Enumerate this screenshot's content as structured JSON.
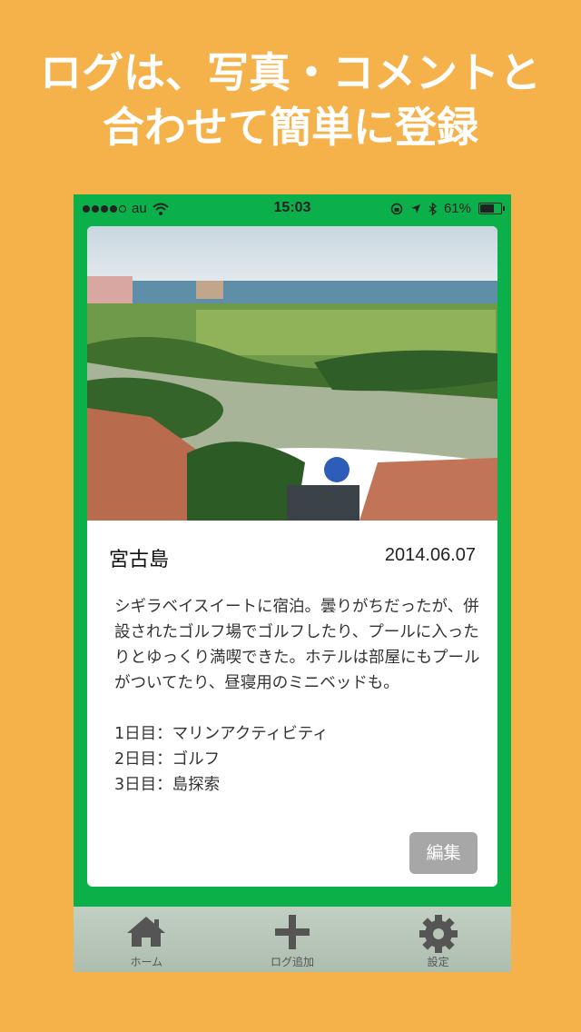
{
  "headline": {
    "line1": "ログは、写真・コメントと",
    "line2": "合わせて簡単に登録"
  },
  "colors": {
    "background": "#f5b24a",
    "frame": "#0bb04a",
    "tabbar": "#b6c6b7",
    "edit_button": "#a7a7a7"
  },
  "status_bar": {
    "carrier": "au",
    "time": "15:03",
    "battery": "61%",
    "battery_level": 0.61
  },
  "log": {
    "photo_alt": "photo",
    "place": "宮古島",
    "date": "2014.06.07",
    "comment": "シギラベイスイートに宿泊。曇りがちだったが、併設されたゴルフ場でゴルフしたり、プールに入ったりとゆっくり満喫できた。ホテルは部屋にもプールがついてたり、昼寝用のミニベッドも。\n\n1日目：マリンアクティビティ\n2日目：ゴルフ\n3日目：島探索",
    "edit_label": "編集"
  },
  "tabs": [
    {
      "label": "ホーム",
      "icon": "home-icon"
    },
    {
      "label": "ログ追加",
      "icon": "plus-icon"
    },
    {
      "label": "設定",
      "icon": "gear-icon"
    }
  ]
}
